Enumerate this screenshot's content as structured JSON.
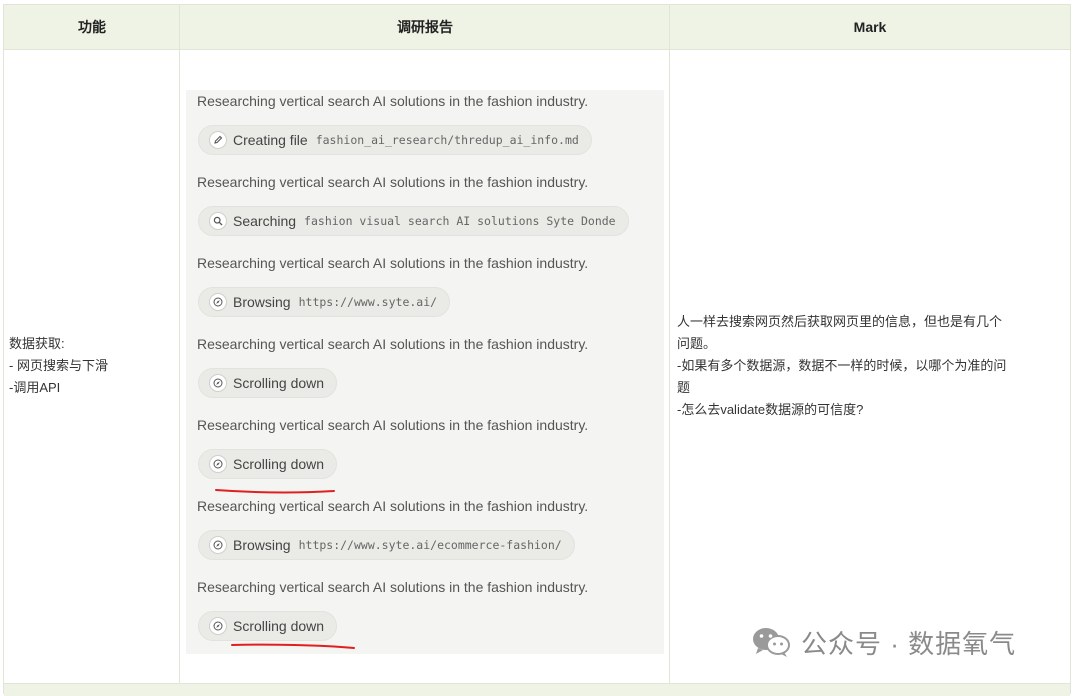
{
  "table": {
    "headers": [
      "功能",
      "调研报告",
      "Mark"
    ],
    "feature_cell": [
      "数据获取:",
      "- 网页搜索与下滑",
      "-调用API"
    ],
    "mark_cell": [
      "人一样去搜索网页然后获取网页里的信息，但也是有几个",
      "问题。",
      "-如果有多个数据源，数据不一样的时候，以哪个为准的问",
      "题",
      "-怎么去validate数据源的可信度?"
    ]
  },
  "screenshot": {
    "steps": [
      {
        "message": "Researching vertical search AI solutions in the fashion industry.",
        "action": "Creating file",
        "arg": "fashion_ai_research/thredup_ai_info.md",
        "icon": "edit-icon"
      },
      {
        "message": "Researching vertical search AI solutions in the fashion industry.",
        "action": "Searching",
        "arg": "fashion visual search AI solutions Syte Donde",
        "icon": "search-icon"
      },
      {
        "message": "Researching vertical search AI solutions in the fashion industry.",
        "action": "Browsing",
        "arg": "https://www.syte.ai/",
        "icon": "compass-icon"
      },
      {
        "message": "Researching vertical search AI solutions in the fashion industry.",
        "action": "Scrolling down",
        "arg": "",
        "icon": "compass-icon"
      },
      {
        "message": "Researching vertical search AI solutions in the fashion industry.",
        "action": "Scrolling down",
        "arg": "",
        "icon": "compass-icon"
      },
      {
        "message": "Researching vertical search AI solutions in the fashion industry.",
        "action": "Browsing",
        "arg": "https://www.syte.ai/ecommerce-fashion/",
        "icon": "compass-icon"
      },
      {
        "message": "Researching vertical search AI solutions in the fashion industry.",
        "action": "Scrolling down",
        "arg": "",
        "icon": "compass-icon"
      }
    ]
  },
  "watermark": {
    "text": "公众号 · 数据氧气",
    "icon": "wechat-icon"
  },
  "colors": {
    "header_bg": "#eef3e5",
    "border": "#dfe6d6",
    "annotation_red": "#e02020"
  }
}
